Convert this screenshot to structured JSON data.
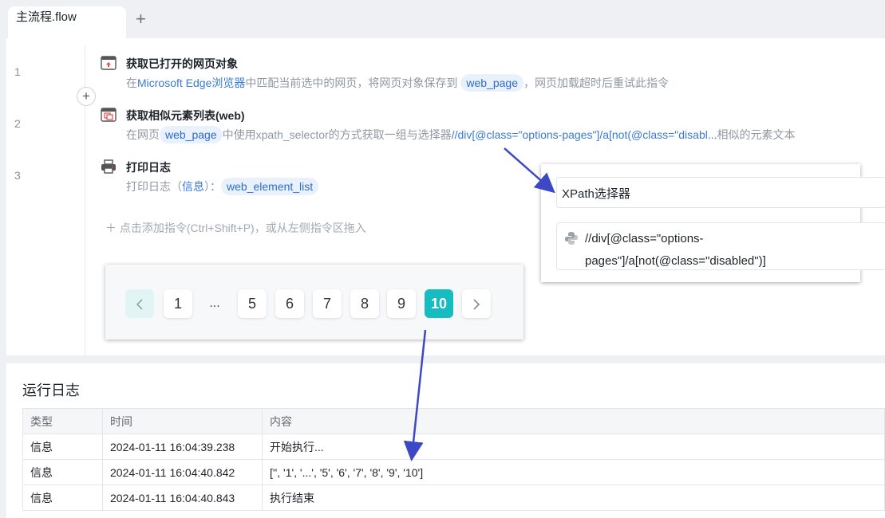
{
  "tabs": {
    "active_label": "主流程.flow",
    "add_label": "+"
  },
  "steps": [
    {
      "line": "1",
      "title": "获取已打开的网页对象",
      "desc_prefix": "在",
      "desc_link": "Microsoft Edge浏览器",
      "desc_mid": "中匹配当前选中的网页，将网页对象保存到",
      "desc_var": "web_page",
      "desc_suffix": "，网页加载超时后重试此指令"
    },
    {
      "line": "2",
      "title": "获取相似元素列表(web)",
      "desc_prefix": "在网页",
      "desc_var": "web_page",
      "desc_mid": "中使用xpath_selector的方式获取一组与选择器",
      "desc_link": "//div[@class=\"options-pages\"]/a[not(@class=\"disabl...",
      "desc_suffix": "相似的元素文本"
    },
    {
      "line": "3",
      "title": "打印日志",
      "desc_prefix": "打印日志（",
      "desc_link": "信息",
      "desc_mid": "）：",
      "desc_var": "web_element_list"
    }
  ],
  "add_hint": "点击添加指令(Ctrl+Shift+P)，或从左侧指令区拖入",
  "pagination": {
    "pages": [
      "1",
      "...",
      "5",
      "6",
      "7",
      "8",
      "9",
      "10"
    ],
    "active": "10"
  },
  "xpath_popup": {
    "label": "XPath选择器",
    "value": "//div[@class=\"options-pages\"]/a[not(@class=\"disabled\")]"
  },
  "log": {
    "title": "运行日志",
    "columns": [
      "类型",
      "时间",
      "内容"
    ],
    "rows": [
      [
        "信息",
        "2024-01-11 16:04:39.238",
        "开始执行..."
      ],
      [
        "信息",
        "2024-01-11 16:04:40.842",
        "['', '1', '...', '5', '6', '7', '8', '9', '10']"
      ],
      [
        "信息",
        "2024-01-11 16:04:40.843",
        "执行结束"
      ]
    ]
  },
  "colors": {
    "accent": "#17bcc1",
    "link": "#3a7bd5",
    "arrow": "#3d48c7"
  }
}
